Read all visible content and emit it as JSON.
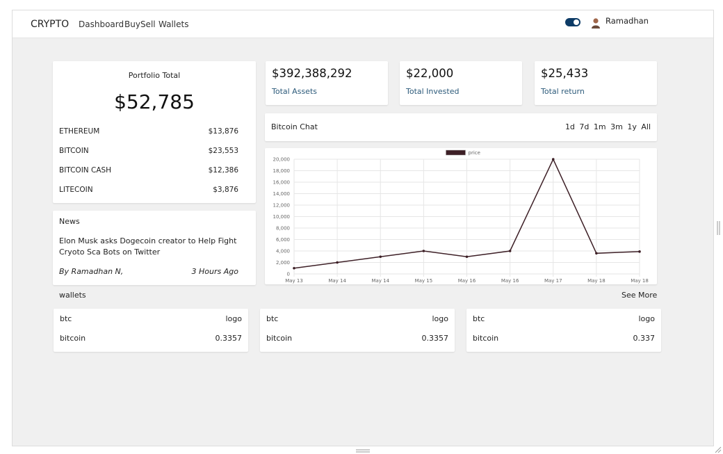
{
  "nav": {
    "brand": "CRYPTO",
    "links": [
      "Dashboard",
      "BuySell",
      "Wallets"
    ],
    "user": "Ramadhan",
    "theme_toggle_color": "#0d3b66"
  },
  "portfolio": {
    "title": "Portfolio Total",
    "total": "$52,785",
    "coins": [
      {
        "name": "ETHEREUM",
        "value": "$13,876"
      },
      {
        "name": "BITCOIN",
        "value": "$23,553"
      },
      {
        "name": "BITCOIN CASH",
        "value": "$12,386"
      },
      {
        "name": "LITECOIN",
        "value": "$3,876"
      }
    ]
  },
  "news": {
    "heading": "News",
    "title": "Elon Musk asks Dogecoin creator to Help Fight Cryoto Sca Bots on Twitter",
    "author": "By Ramadhan N,",
    "time": "3 Hours Ago"
  },
  "stats": [
    {
      "value": "$392,388,292",
      "label": "Total Assets"
    },
    {
      "value": "$22,000",
      "label": "Total Invested"
    },
    {
      "value": "$25,433",
      "label": "Total return"
    }
  ],
  "chat": {
    "title": "Bitcoin Chat",
    "ranges": [
      "1d",
      "7d",
      "1m",
      "3m",
      "1y",
      "All"
    ]
  },
  "chart_data": {
    "type": "line",
    "x": [
      "May 13",
      "May 14",
      "May 14",
      "May 15",
      "May 16",
      "May 16",
      "May 17",
      "May 18",
      "May 18"
    ],
    "series": [
      {
        "name": "price",
        "values": [
          1000,
          2000,
          3000,
          4000,
          3000,
          4000,
          20000,
          3600,
          3900
        ]
      }
    ],
    "yticks": [
      "0",
      "2,000",
      "4,000",
      "6,000",
      "8,000",
      "10,000",
      "12,000",
      "14,000",
      "16,000",
      "18,000",
      "20,000"
    ],
    "ylim": [
      0,
      20000
    ],
    "legend": "top",
    "line_color": "#3d1f26",
    "grid": true
  },
  "wallets": {
    "label": "wallets",
    "see_more": "See More",
    "items": [
      {
        "symbol": "btc",
        "logo": "logo",
        "name": "bitcoin",
        "amount": "0.3357"
      },
      {
        "symbol": "btc",
        "logo": "logo",
        "name": "bitcoin",
        "amount": "0.3357"
      },
      {
        "symbol": "btc",
        "logo": "logo",
        "name": "bitcoin",
        "amount": "0.337"
      }
    ]
  }
}
